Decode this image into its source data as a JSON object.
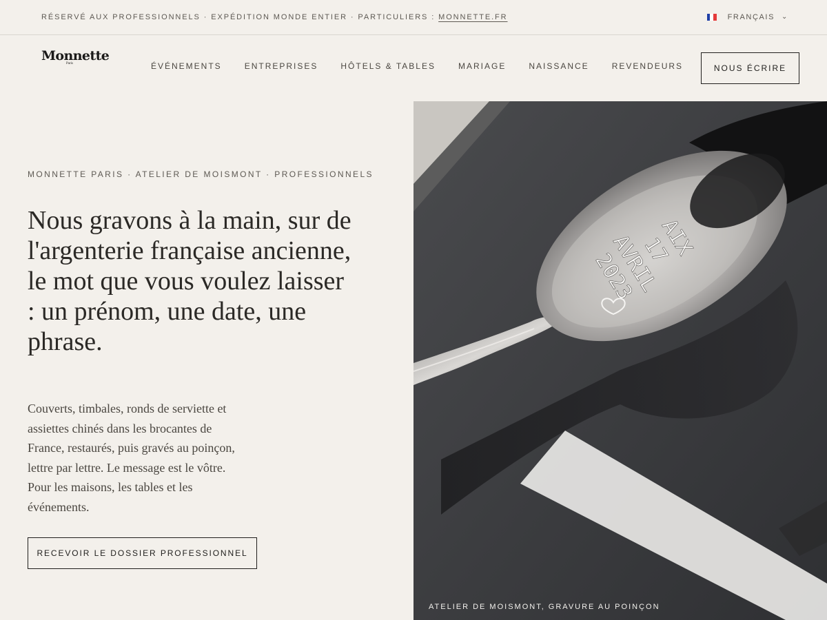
{
  "topbar": {
    "message": "RÉSERVÉ AUX PROFESSIONNELS · EXPÉDITION MONDE ENTIER · PARTICULIERS : ",
    "link": "MONNETTE.FR",
    "language": "FRANÇAIS",
    "flag_colors": [
      "#1f3fa6",
      "#ffffff",
      "#e53b3b"
    ]
  },
  "header": {
    "logo": "Monnette",
    "logo_sub": "Paris",
    "nav": [
      "ÉVÉNEMENTS",
      "ENTREPRISES",
      "HÔTELS & TABLES",
      "MARIAGE",
      "NAISSANCE",
      "REVENDEURS"
    ],
    "contact_button": "NOUS ÉCRIRE"
  },
  "hero": {
    "eyebrow": "MONNETTE PARIS · ATELIER DE MOISMONT · PROFESSIONNELS",
    "headline": "Nous gravons à la main, sur de l'argenterie française ancienne, le mot que vous voulez laisser : un prénom, une date, une phrase.",
    "body": "Couverts, timbales, ronds de serviette et assiettes chinés dans les brocantes de France, restaurés, puis gravés au poinçon, lettre par lettre. Le message est le vôtre. Pour les maisons, les tables et les événements.",
    "cta_button": "RECEVOIR LE DOSSIER PROFESSIONNEL"
  },
  "image": {
    "engraving_lines": [
      "AIX",
      "17",
      "AVRIL",
      "2023"
    ],
    "heart_icon": "heart-icon",
    "caption": "ATELIER DE MOISMONT, GRAVURE AU POINÇON"
  }
}
